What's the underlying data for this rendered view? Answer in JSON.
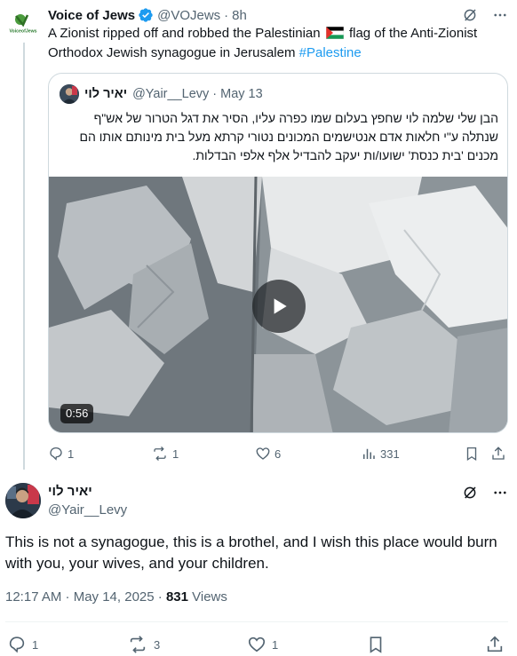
{
  "parent": {
    "name": "Voice of Jews",
    "handle": "@VOJews",
    "separator": "·",
    "time": "8h",
    "avatar_text": "VoiceofJews",
    "text_before_flag": "A Zionist ripped off and robbed the Palestinian ",
    "text_after_flag": " flag of the Anti-Zionist Orthodox Jewish synagogue in Jerusalem ",
    "hashtag": "#Palestine",
    "stats": {
      "replies": "1",
      "reposts": "1",
      "likes": "6",
      "views": "331"
    }
  },
  "quote": {
    "name": "יאיר לוי",
    "handle": "@Yair__Levy",
    "separator": "·",
    "date": "May 13",
    "text": "הבן שלי שלמה לוי שחפץ בעלום שמו כפרה עליו, הסיר את דגל הטרור של אש\"ף שנתלה ע\"י חלאות אדם אנטישמים המכונים נטורי קרתא מעל בית מינותם אותו הם מכנים 'בית כנסת' ישועו/ות יעקב להבדיל אלף אלפי הבדלות.",
    "video_duration": "0:56"
  },
  "main": {
    "name": "יאיר לוי",
    "handle": "@Yair__Levy",
    "text": "This is not a synagogue, this is a brothel, and I wish this place would burn with you, your wives, and your children.",
    "timestamp": "12:17 AM · May 14, 2025 · ",
    "views_count": "831",
    "views_label": " Views",
    "stats": {
      "replies": "1",
      "reposts": "3",
      "likes": "1"
    }
  },
  "colors": {
    "accent": "#1d9bf0",
    "verified": "#1d9bf0",
    "muted": "#536471",
    "border": "#cfd9de"
  },
  "icons": [
    "verified-icon",
    "grok-icon",
    "more-icon",
    "reply-icon",
    "repost-icon",
    "like-icon",
    "views-icon",
    "bookmark-icon",
    "share-icon",
    "play-icon"
  ]
}
